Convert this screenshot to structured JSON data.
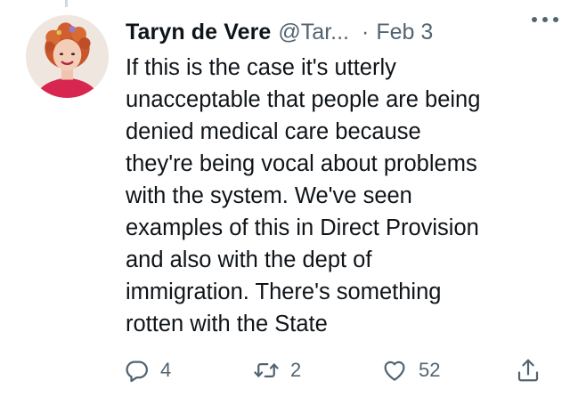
{
  "tweet": {
    "author_name": "Taryn de Vere",
    "author_handle": "@Tar...",
    "separator": "·",
    "date": "Feb 3",
    "text_lines": [
      "If this is the case it's utterly",
      "unacceptable that people are being",
      "denied medical care because",
      "they're being vocal about problems",
      "with the system. We've seen",
      "examples of this in Direct Provision",
      "and also with the dept of",
      "immigration. There's something",
      "rotten with the State"
    ]
  },
  "actions": {
    "reply": {
      "icon": "reply-icon",
      "count": "4"
    },
    "retweet": {
      "icon": "retweet-icon",
      "count": "2"
    },
    "like": {
      "icon": "heart-icon",
      "count": "52"
    },
    "share": {
      "icon": "share-icon"
    }
  },
  "colors": {
    "text": "#0f1419",
    "secondary": "#536471",
    "background": "#ffffff"
  }
}
